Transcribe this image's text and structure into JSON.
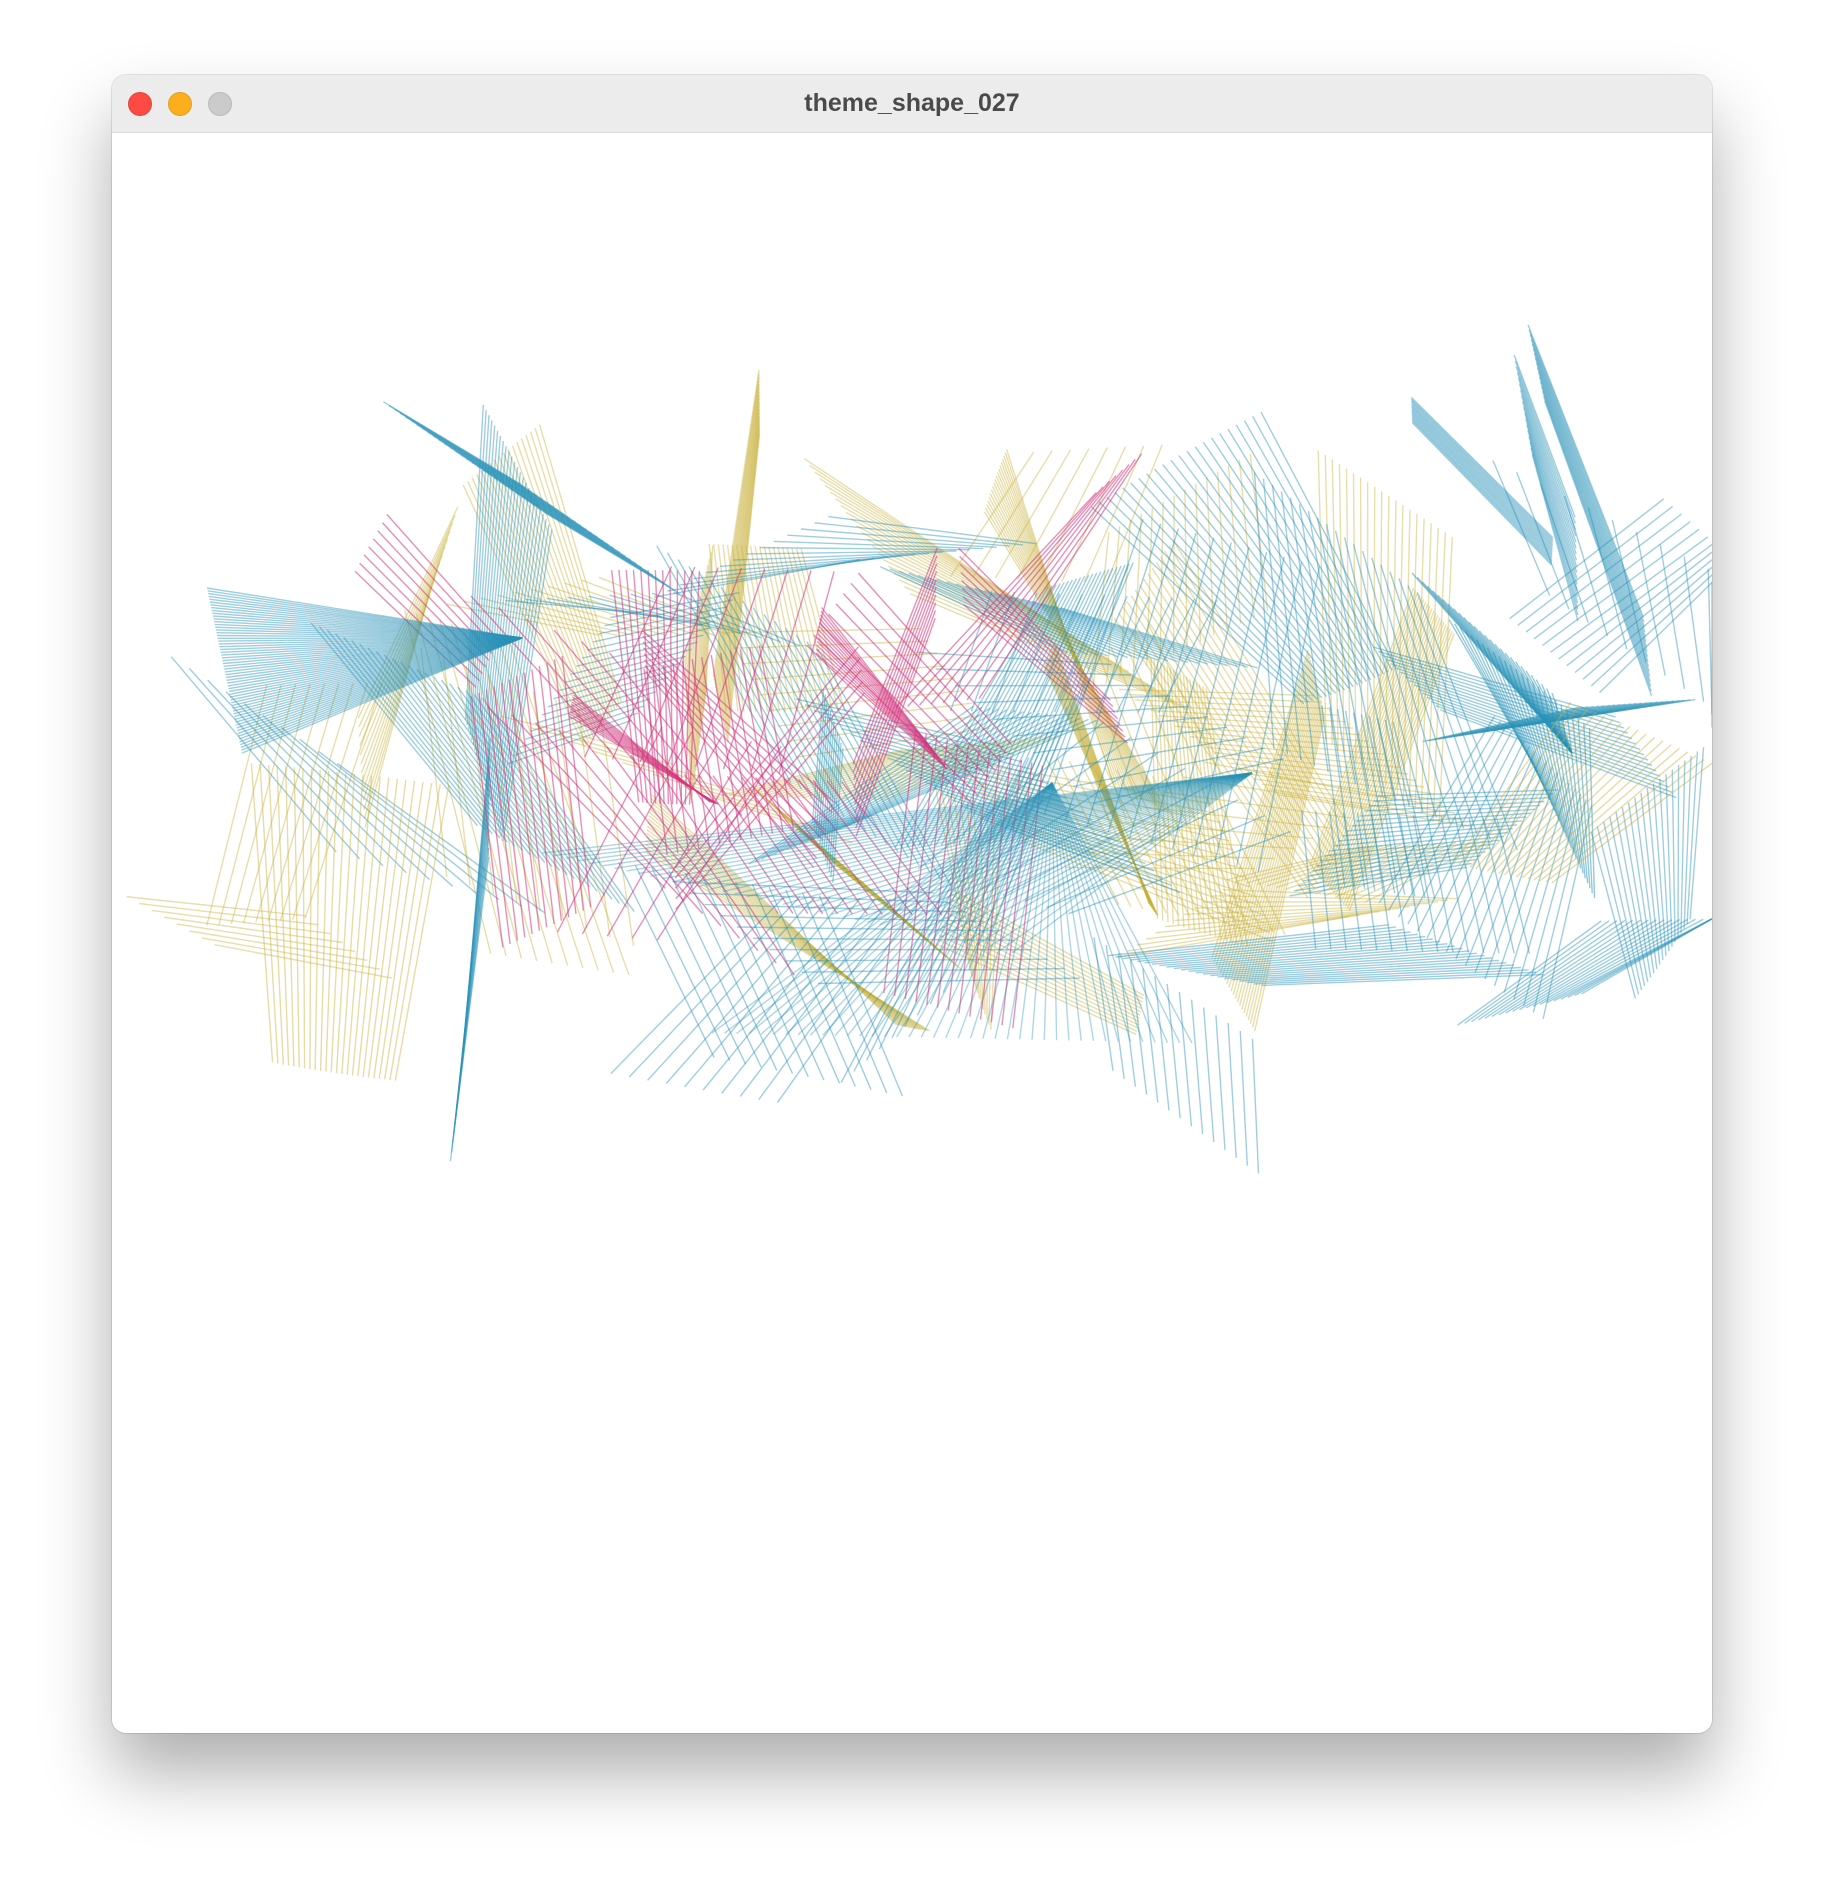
{
  "window": {
    "title": "theme_shape_027"
  },
  "controls": {
    "close": "close-button",
    "minimize": "minimize-button",
    "zoom": "zoom-button"
  },
  "artwork": {
    "background": "#ffffff",
    "palette": {
      "olive": "#c9b03a",
      "teal": "#2a93b8",
      "magenta": "#d2357d"
    }
  }
}
